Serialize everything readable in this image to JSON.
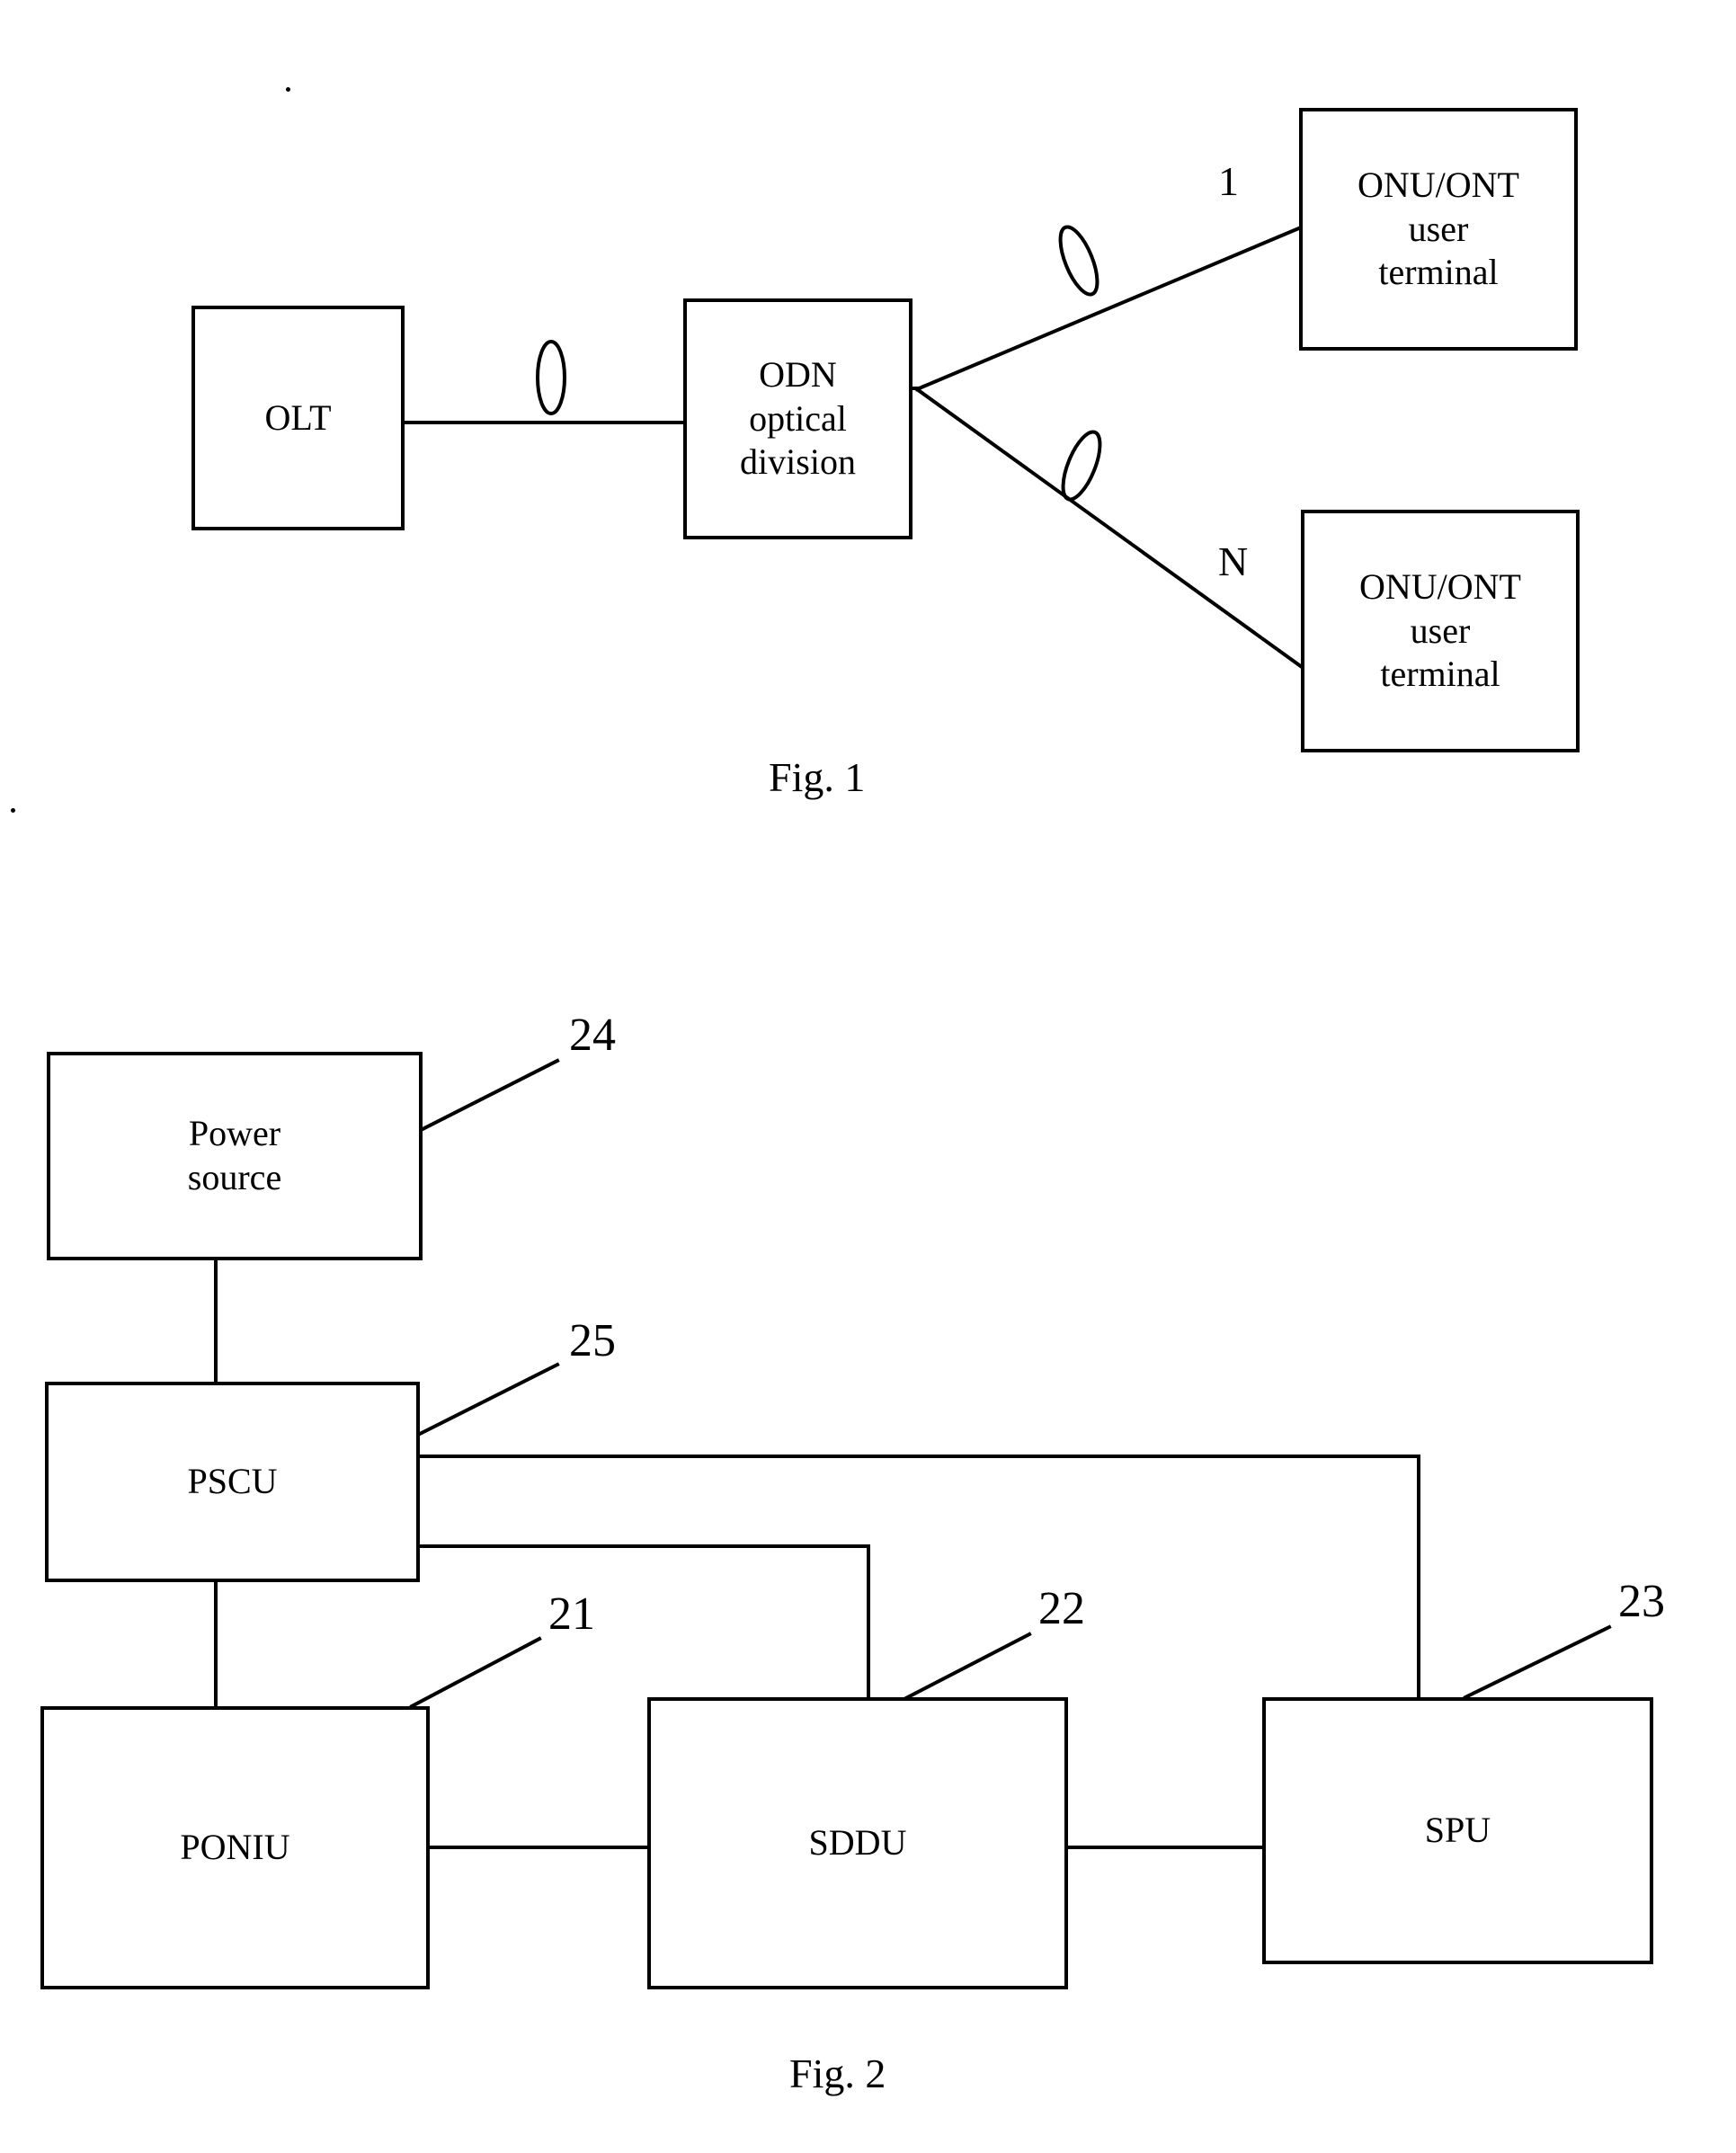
{
  "document": {
    "type": "patent-drawing-sheet",
    "figures": [
      {
        "caption": "Fig. 1",
        "title": "PON network topology",
        "boxes": [
          {
            "id": "olt",
            "label": "OLT"
          },
          {
            "id": "odn",
            "label": "ODN\noptical\ndivision"
          },
          {
            "id": "onu1",
            "label": "ONU/ONT\nuser\nterminal"
          },
          {
            "id": "onuN",
            "label": "ONU/ONT\nuser\nterminal"
          }
        ],
        "connection_labels": [
          {
            "id": "branch-1",
            "text": "1"
          },
          {
            "id": "branch-n",
            "text": "N"
          }
        ],
        "fiber_symbols": 3
      },
      {
        "caption": "Fig. 2",
        "title": "Device block diagram",
        "boxes": [
          {
            "id": "power-source",
            "label": "Power\nsource"
          },
          {
            "id": "pscu",
            "label": "PSCU"
          },
          {
            "id": "poniu",
            "label": "PONIU"
          },
          {
            "id": "sddu",
            "label": "SDDU"
          },
          {
            "id": "spu",
            "label": "SPU"
          }
        ],
        "reference_numerals": [
          {
            "id": "ref-24",
            "text": "24",
            "points_to": "power-source"
          },
          {
            "id": "ref-25",
            "text": "25",
            "points_to": "pscu"
          },
          {
            "id": "ref-21",
            "text": "21",
            "points_to": "poniu"
          },
          {
            "id": "ref-22",
            "text": "22",
            "points_to": "sddu"
          },
          {
            "id": "ref-23",
            "text": "23",
            "points_to": "spu"
          }
        ]
      }
    ]
  },
  "fig1": {
    "caption": "Fig. 1",
    "olt": {
      "label": "OLT"
    },
    "odn": {
      "label": "ODN\noptical\ndivision"
    },
    "onu_top": {
      "label": "ONU/ONT\nuser\nterminal"
    },
    "onu_bottom": {
      "label": "ONU/ONT\nuser\nterminal"
    },
    "branch_top_label": "1",
    "branch_bottom_label": "N"
  },
  "fig2": {
    "caption": "Fig. 2",
    "power_source": {
      "label": "Power\nsource"
    },
    "pscu": {
      "label": "PSCU"
    },
    "poniu": {
      "label": "PONIU"
    },
    "sddu": {
      "label": "SDDU"
    },
    "spu": {
      "label": "SPU"
    },
    "ref_24": "24",
    "ref_25": "25",
    "ref_21": "21",
    "ref_22": "22",
    "ref_23": "23"
  },
  "colors": {
    "ink": "#000000",
    "paper": "#ffffff"
  }
}
